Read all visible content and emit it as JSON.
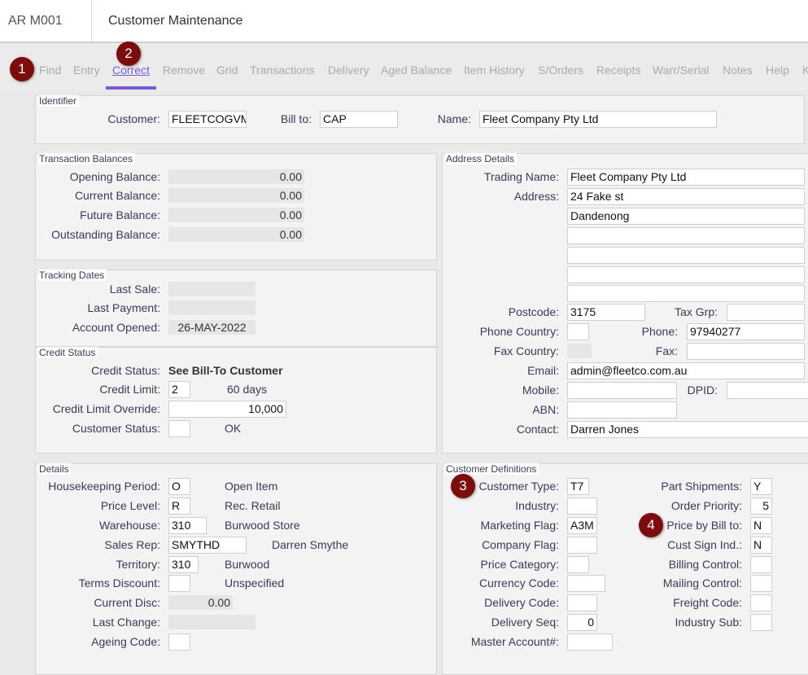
{
  "header": {
    "code": "AR M001",
    "title": "Customer Maintenance"
  },
  "toolbar": {
    "tabs": [
      "Find",
      "Entry",
      "Correct",
      "Remove",
      "Grid",
      "Transactions",
      "Delivery",
      "Aged Balance",
      "Item History",
      "S/Orders",
      "Receipts",
      "Warr/Serial",
      "Notes",
      "Help",
      "K"
    ],
    "active": "Correct",
    "accent": "#7b5bd6"
  },
  "badges": [
    "1",
    "2",
    "3",
    "4"
  ],
  "identifier": {
    "title": "Identifier",
    "customer_label": "Customer:",
    "customer": "FLEETCOGVM",
    "billto_label": "Bill to:",
    "billto": "CAP",
    "name_label": "Name:",
    "name": "Fleet Company Pty Ltd"
  },
  "balances": {
    "title": "Transaction Balances",
    "rows": [
      {
        "label": "Opening Balance:",
        "value": "0.00"
      },
      {
        "label": "Current Balance:",
        "value": "0.00"
      },
      {
        "label": "Future Balance:",
        "value": "0.00"
      },
      {
        "label": "Outstanding Balance:",
        "value": "0.00"
      }
    ]
  },
  "tracking": {
    "title": "Tracking Dates",
    "last_sale_label": "Last Sale:",
    "last_sale": "",
    "last_payment_label": "Last Payment:",
    "last_payment": "",
    "opened_label": "Account Opened:",
    "opened": "26-MAY-2022"
  },
  "credit": {
    "title": "Credit Status",
    "status_label": "Credit Status:",
    "status": "See Bill-To Customer",
    "limit_label": "Credit Limit:",
    "limit": "2",
    "limit_desc": "60 days",
    "override_label": "Credit Limit Override:",
    "override": "10,000",
    "cust_status_label": "Customer Status:",
    "cust_status": "",
    "cust_status_desc": "OK"
  },
  "address": {
    "title": "Address Details",
    "trading_label": "Trading Name:",
    "trading": "Fleet Company Pty Ltd",
    "address_label": "Address:",
    "lines": [
      "24 Fake st",
      "Dandenong",
      "",
      "",
      "",
      ""
    ],
    "postcode_label": "Postcode:",
    "postcode": "3175",
    "taxgrp_label": "Tax Grp:",
    "taxgrp": "",
    "phone_country_label": "Phone Country:",
    "phone_country": "",
    "phone_label": "Phone:",
    "phone": "97940277",
    "fax_country_label": "Fax Country:",
    "fax_label": "Fax:",
    "fax": "",
    "email_label": "Email:",
    "email": "admin@fleetco.com.au",
    "mobile_label": "Mobile:",
    "mobile": "",
    "dpid_label": "DPID:",
    "dpid": "",
    "abn_label": "ABN:",
    "abn": "",
    "contact_label": "Contact:",
    "contact": "Darren Jones"
  },
  "details": {
    "title": "Details",
    "rows": [
      {
        "label": "Housekeeping Period:",
        "value": "O",
        "desc": "Open Item"
      },
      {
        "label": "Price Level:",
        "value": "R",
        "desc": "Rec. Retail"
      },
      {
        "label": "Warehouse:",
        "value": "310",
        "desc": "Burwood Store"
      },
      {
        "label": "Sales Rep:",
        "value": "SMYTHD",
        "desc": "Darren Smythe"
      },
      {
        "label": "Territory:",
        "value": "310",
        "desc": "Burwood"
      },
      {
        "label": "Terms Discount:",
        "value": "",
        "desc": "Unspecified"
      },
      {
        "label": "Current Disc:",
        "value": "0.00"
      },
      {
        "label": "Last Change:",
        "value": ""
      },
      {
        "label": "Ageing Code:",
        "value": ""
      }
    ]
  },
  "definitions": {
    "title": "Customer Definitions",
    "left": [
      {
        "label": "Customer Type:",
        "value": "T7"
      },
      {
        "label": "Industry:",
        "value": ""
      },
      {
        "label": "Marketing Flag:",
        "value": "A3M"
      },
      {
        "label": "Company Flag:",
        "value": ""
      },
      {
        "label": "Price Category:",
        "value": ""
      },
      {
        "label": "Currency Code:",
        "value": ""
      },
      {
        "label": "Delivery Code:",
        "value": ""
      },
      {
        "label": "Delivery Seq:",
        "value": "0"
      },
      {
        "label": "Master Account#:",
        "value": ""
      }
    ],
    "right": [
      {
        "label": "Part Shipments:",
        "value": "Y"
      },
      {
        "label": "Order Priority:",
        "value": "5"
      },
      {
        "label": "Price by Bill to:",
        "value": "N"
      },
      {
        "label": "Cust Sign Ind.:",
        "value": "N"
      },
      {
        "label": "Billing Control:",
        "value": ""
      },
      {
        "label": "Mailing Control:",
        "value": ""
      },
      {
        "label": "Freight Code:",
        "value": ""
      },
      {
        "label": "Industry Sub:",
        "value": ""
      }
    ]
  }
}
